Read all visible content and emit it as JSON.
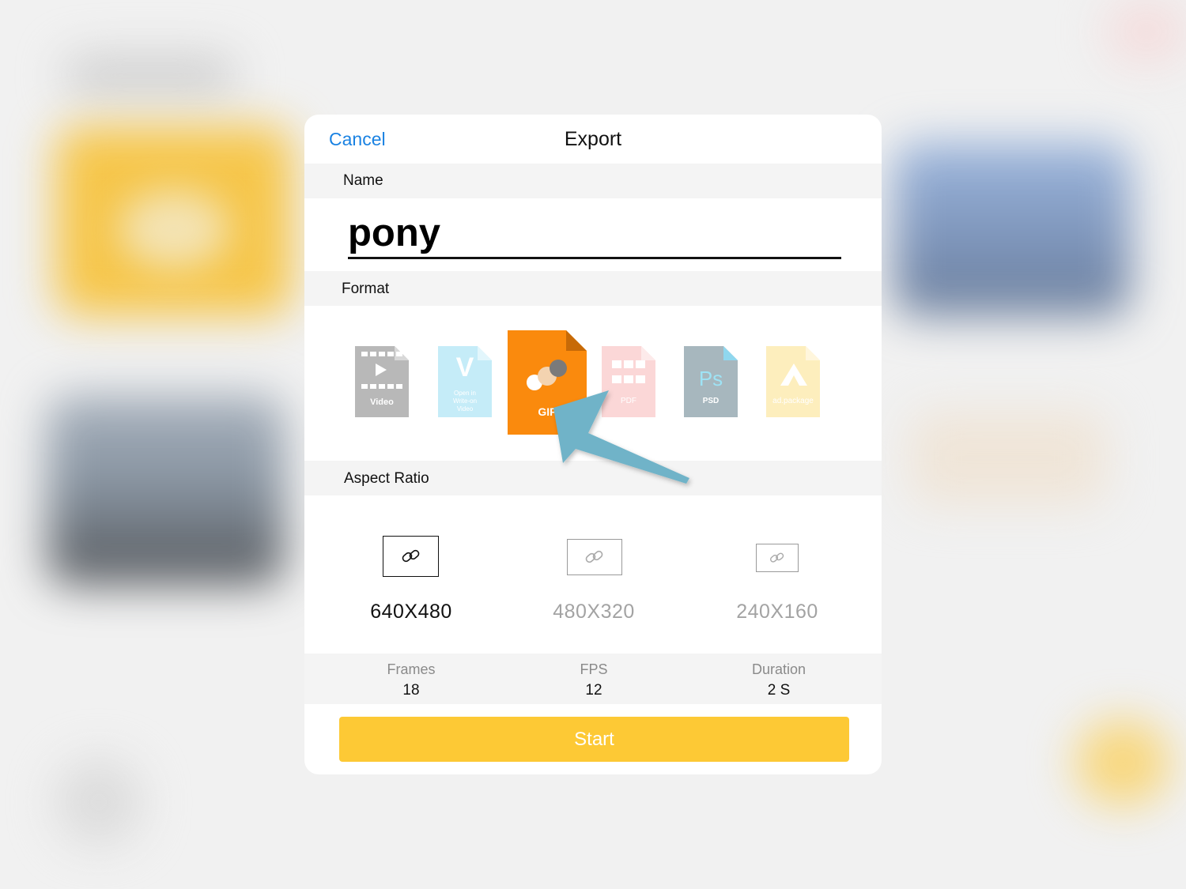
{
  "colors": {
    "accent_link": "#1a82e2",
    "start_button": "#fdc935",
    "gif_selected": "#fa8a0d",
    "annotation_arrow": "#6fb3c8"
  },
  "nav": {
    "cancel_label": "Cancel",
    "title": "Export"
  },
  "sections": {
    "name": "Name",
    "format": "Format",
    "aspect_ratio": "Aspect Ratio"
  },
  "name_field": {
    "value": "pony"
  },
  "formats": [
    {
      "id": "video",
      "label": "Video",
      "icon": "video-file-icon"
    },
    {
      "id": "write-on",
      "label_lines": [
        "Open in",
        "Write-on",
        "Video"
      ],
      "glyph": "V",
      "icon": "write-on-video-file-icon"
    },
    {
      "id": "gif",
      "label": "GIF",
      "selected": true,
      "icon": "gif-file-icon"
    },
    {
      "id": "pdf",
      "label": "PDF",
      "icon": "pdf-file-icon"
    },
    {
      "id": "psd",
      "label": "PSD",
      "glyph": "Ps",
      "icon": "psd-file-icon"
    },
    {
      "id": "adpackage",
      "label": "ad.package",
      "icon": "ad-package-file-icon"
    }
  ],
  "aspect_ratios": [
    {
      "label": "640X480",
      "selected": true,
      "icon": "link-icon"
    },
    {
      "label": "480X320",
      "selected": false,
      "icon": "link-icon"
    },
    {
      "label": "240X160",
      "selected": false,
      "icon": "link-icon"
    }
  ],
  "stats": {
    "frames": {
      "label": "Frames",
      "value": "18"
    },
    "fps": {
      "label": "FPS",
      "value": "12"
    },
    "duration": {
      "label": "Duration",
      "value": "2 S"
    }
  },
  "start_label": "Start"
}
